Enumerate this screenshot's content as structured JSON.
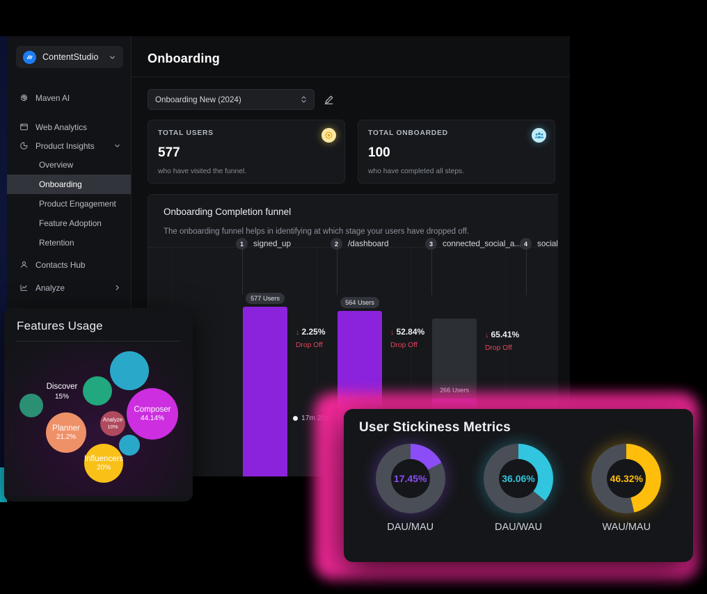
{
  "sidebar": {
    "brand": {
      "name": "ContentStudio",
      "logo_icon": "contentstudio-logo-icon",
      "chevron_icon": "chevron-down-icon"
    },
    "items": [
      {
        "label": "Maven AI",
        "icon": "fingerprint-icon",
        "type": "item"
      },
      {
        "label": "Web Analytics",
        "icon": "browser-window-icon",
        "type": "item"
      },
      {
        "label": "Product Insights",
        "icon": "pie-chart-icon",
        "type": "group",
        "chevron": "chevron-down-icon",
        "expanded": true
      },
      {
        "label": "Overview",
        "type": "sub"
      },
      {
        "label": "Onboarding",
        "type": "sub",
        "active": true
      },
      {
        "label": "Product Engagement",
        "type": "sub"
      },
      {
        "label": "Feature Adoption",
        "type": "sub"
      },
      {
        "label": "Retention",
        "type": "sub"
      },
      {
        "label": "Contacts Hub",
        "icon": "user-icon",
        "type": "item"
      },
      {
        "label": "Analyze",
        "icon": "chart-area-icon",
        "type": "item",
        "chevron": "chevron-right-icon"
      }
    ]
  },
  "header": {
    "title": "Onboarding"
  },
  "selector": {
    "value": "Onboarding New (2024)",
    "stepper_icon": "up-down-stepper-icon",
    "edit_icon": "edit-pencil-icon"
  },
  "kpis": [
    {
      "label": "TOTAL USERS",
      "value": "577",
      "sub": "who have visited the funnel.",
      "icon": "target-eye-icon",
      "badge_color": "#fbe7a1"
    },
    {
      "label": "TOTAL ONBOARDED",
      "value": "100",
      "sub": "who have completed all steps.",
      "icon": "users-group-icon",
      "badge_color": "#bfeaf7"
    }
  ],
  "funnel_panel": {
    "title": "Onboarding Completion funnel",
    "description": "The onboarding funnel helps in identifying at which stage your users have dropped off."
  },
  "features_card": {
    "title": "Features Usage"
  },
  "stickiness_card": {
    "title": "User Stickiness Metrics"
  },
  "chart_data": [
    {
      "type": "bar",
      "name": "onboarding-completion-funnel",
      "title": "Onboarding Completion funnel",
      "subtitle": "The onboarding funnel helps in identifying at which stage your users have dropped off.",
      "xlabel": "",
      "ylabel": "Users",
      "categories": [
        "signed_up",
        "/dashboard",
        "connected_social_a...",
        "social_post_"
      ],
      "step_numbers": [
        "1",
        "2",
        "3",
        "4"
      ],
      "values": [
        577,
        564,
        266,
        null
      ],
      "value_labels": [
        "577 Users",
        "564 Users",
        "266 Users",
        ""
      ],
      "dropoffs": [
        {
          "pct": "2.25%",
          "caption": "Drop Off",
          "arrow": "down"
        },
        {
          "pct": "52.84%",
          "caption": "Drop Off",
          "arrow": "down"
        },
        {
          "pct": "65.41%",
          "caption": "Drop Off",
          "arrow": "down"
        }
      ],
      "durations": [
        "17m 20s"
      ],
      "bar_color": "#8b23dd",
      "ghost_color": "#2c2f34",
      "dropoff_color": "#e4455c",
      "grid": true,
      "ylim": [
        0,
        600
      ]
    },
    {
      "type": "bubble",
      "name": "features-usage",
      "title": "Features Usage",
      "labels": [
        "Composer",
        "Planner",
        "Influencers",
        "Discover",
        "Analyze"
      ],
      "values": [
        44.14,
        21.2,
        20,
        15,
        10
      ],
      "value_labels": [
        "44.14%",
        "21.2%",
        "20%",
        "15%",
        "10%"
      ],
      "colors": [
        "#cd2ee0",
        "#ef9168",
        "#f9c018",
        "#2aa8c9",
        "#b04a5e"
      ],
      "legend": "none"
    },
    {
      "type": "pie",
      "name": "user-stickiness-metrics",
      "title": "User Stickiness Metrics",
      "categories": [
        "DAU/MAU",
        "DAU/WAU",
        "WAU/MAU"
      ],
      "values": [
        17.45,
        36.06,
        46.32
      ],
      "value_labels": [
        "17.45%",
        "36.06%",
        "46.32%"
      ],
      "colors": [
        "#8b4df7",
        "#31c5e0",
        "#ffbe0b"
      ],
      "track_color": "#4a4f57",
      "donut": true
    }
  ]
}
